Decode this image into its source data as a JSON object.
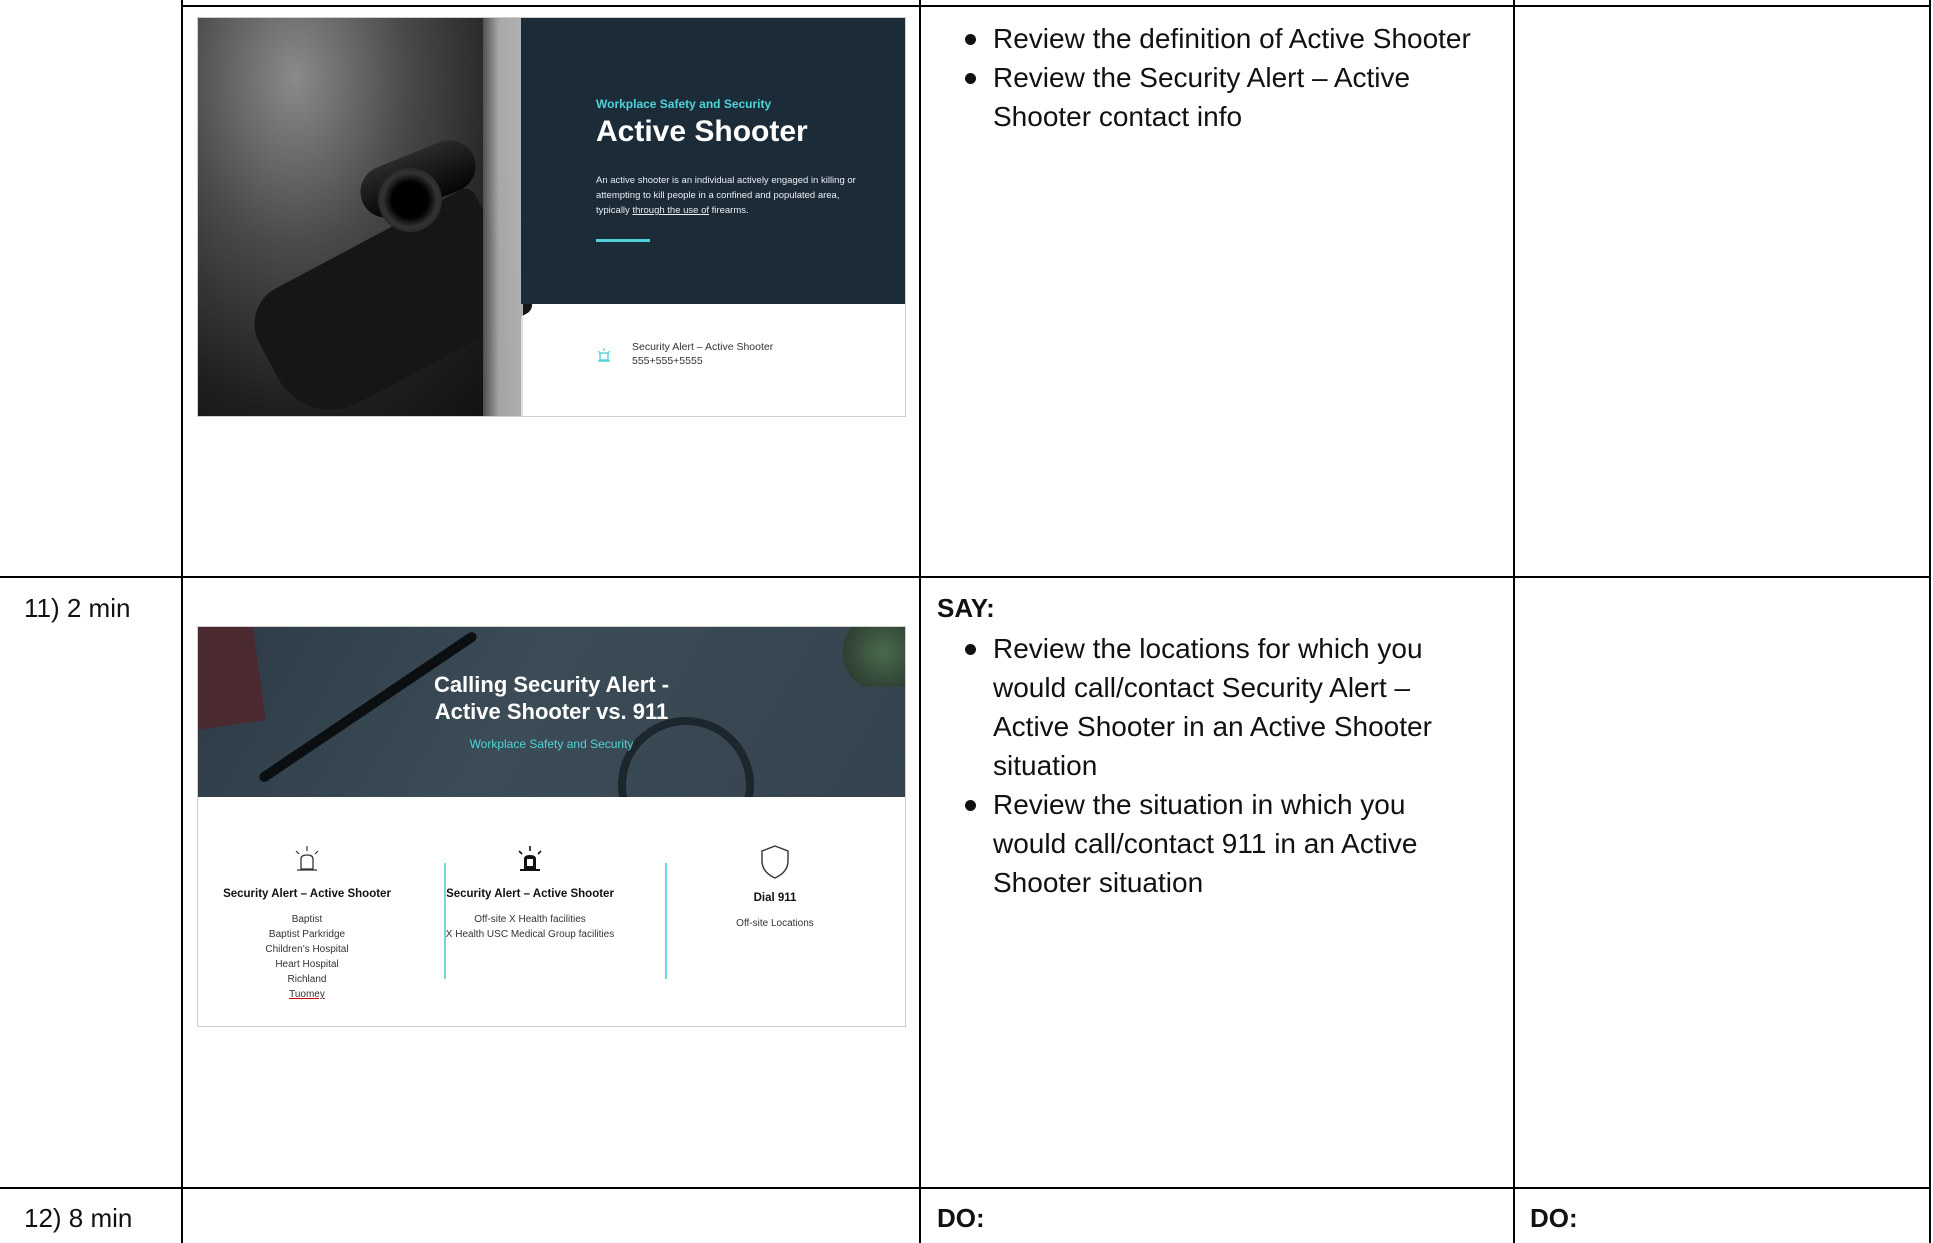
{
  "rows": [
    {
      "time": "",
      "slide": {
        "kicker": "Workplace Safety and Security",
        "title": "Active Shooter",
        "desc_pre": "An active shooter is an individual actively engaged in killing or attempting to kill people in a confined and populated area, typically ",
        "desc_u": "through the use of",
        "desc_post": " firearms.",
        "contact_name": "Security Alert – Active Shooter",
        "contact_phone": "555+555+5555"
      },
      "say_label": "",
      "bullets": [
        "Review the definition of Active Shooter",
        "Review the Security Alert – Active Shooter contact info"
      ]
    },
    {
      "time": "11) 2 min",
      "slide": {
        "title_line1": "Calling Security Alert -",
        "title_line2": "Active Shooter vs. 911",
        "subtitle": "Workplace Safety and Security",
        "columns": [
          {
            "icon": "alarm-light-outline-icon",
            "heading": "Security Alert – Active Shooter",
            "lines": [
              "Baptist",
              "Baptist Parkridge",
              "Children’s Hospital",
              "Heart Hospital",
              "Richland",
              "Tuomey"
            ]
          },
          {
            "icon": "alarm-light-filled-icon",
            "heading": "Security Alert – Active Shooter",
            "lines": [
              "Off-site X Health facilities",
              "X Health USC Medical Group facilities"
            ]
          },
          {
            "icon": "shield-icon",
            "heading": "Dial 911",
            "lines": [
              "Off-site Locations"
            ]
          }
        ]
      },
      "say_label": "SAY:",
      "bullets": [
        "Review the locations for which you would call/contact Security Alert – Active Shooter in an Active Shooter situation",
        "Review the situation in which you would call/contact 911 in an Active Shooter situation"
      ]
    },
    {
      "time": "12) 8 min",
      "do_label": "DO:",
      "do_label_2": "DO:"
    }
  ],
  "colors": {
    "slide_dark": "#1c2b38",
    "accent_teal": "#4fd3d9"
  }
}
